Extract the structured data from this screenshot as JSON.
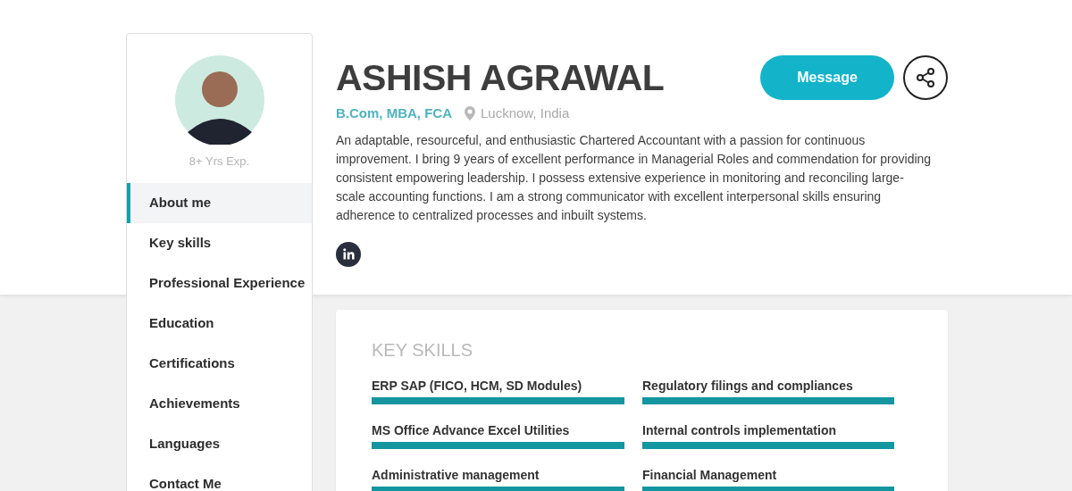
{
  "profile": {
    "experience": "8+ Yrs Exp.",
    "name": "ASHISH AGRAWAL",
    "qualifications": "B.Com, MBA, FCA",
    "location": "Lucknow, India",
    "summary": "An adaptable, resourceful, and enthusiastic Chartered Accountant with a passion for continuous improvement. I bring 9 years of excellent performance in Managerial Roles and commendation for providing consistent empowering leadership. I possess extensive experience in monitoring and reconciling large-scale accounting functions. I am a strong communicator with excellent interpersonal skills ensuring adherence to centralized processes and inbuilt systems."
  },
  "actions": {
    "message_button": "Message"
  },
  "sidebar": {
    "items": [
      {
        "label": "About me",
        "selected": true
      },
      {
        "label": "Key skills",
        "selected": false
      },
      {
        "label": "Professional Experience",
        "selected": false
      },
      {
        "label": "Education",
        "selected": false
      },
      {
        "label": "Certifications",
        "selected": false
      },
      {
        "label": "Achievements",
        "selected": false
      },
      {
        "label": "Languages",
        "selected": false
      },
      {
        "label": "Contact Me",
        "selected": false
      }
    ]
  },
  "key_skills": {
    "title": "KEY SKILLS",
    "skills": [
      {
        "name": "ERP SAP (FICO, HCM, SD Modules)",
        "level": 1
      },
      {
        "name": "Regulatory filings and compliances",
        "level": 1
      },
      {
        "name": "MS Office Advance Excel Utilities",
        "level": 1
      },
      {
        "name": "Internal controls implementation",
        "level": 1
      },
      {
        "name": "Administrative management",
        "level": 1
      },
      {
        "name": "Financial Management",
        "level": 1
      }
    ]
  }
}
